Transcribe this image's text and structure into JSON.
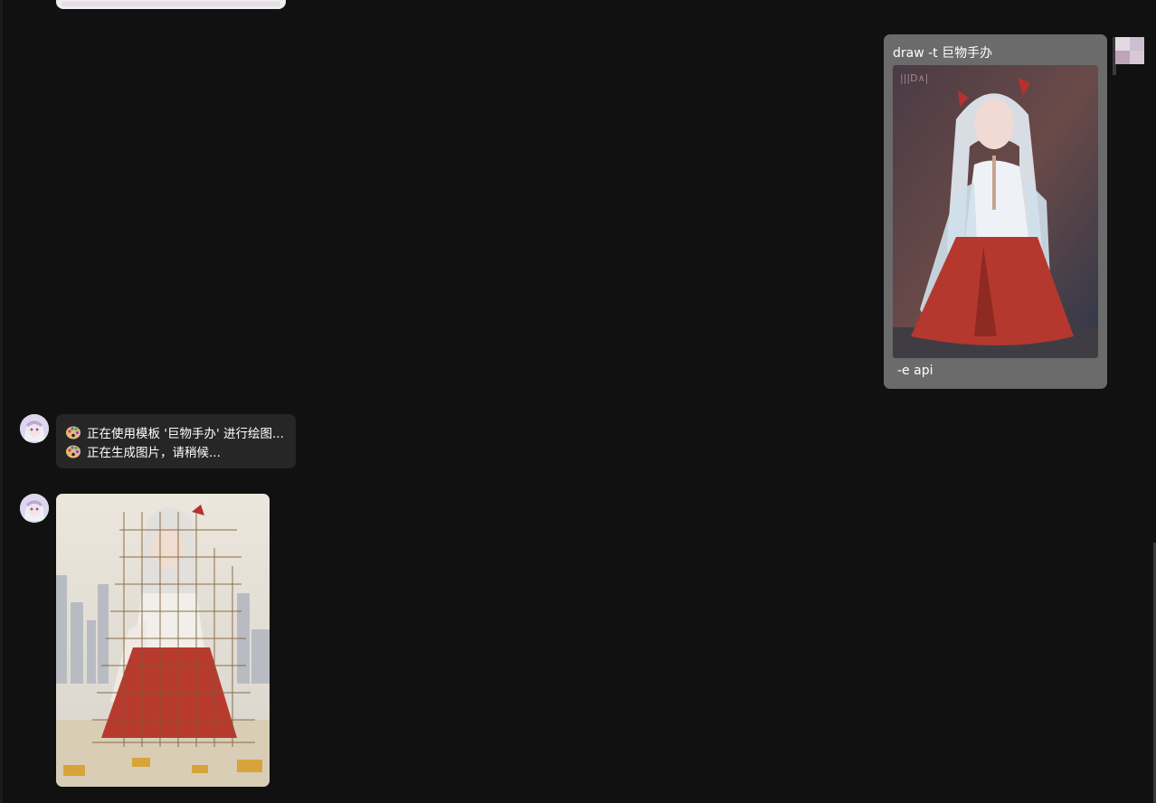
{
  "user_message": {
    "command": "draw -t 巨物手办",
    "extra": "-e api",
    "image_icon": "anime-girl-illustration"
  },
  "bot_status": {
    "icon": "palette-icon",
    "lines": [
      "正在使用模板 '巨物手办' 进行绘图...",
      "正在生成图片，请稍候..."
    ]
  },
  "bot_result": {
    "image_icon": "giant-figure-scaffolding-image"
  },
  "colors": {
    "background": "#111111",
    "user_bubble": "#6b6b6b",
    "bot_bubble": "#262626",
    "text": "#ffffff"
  }
}
